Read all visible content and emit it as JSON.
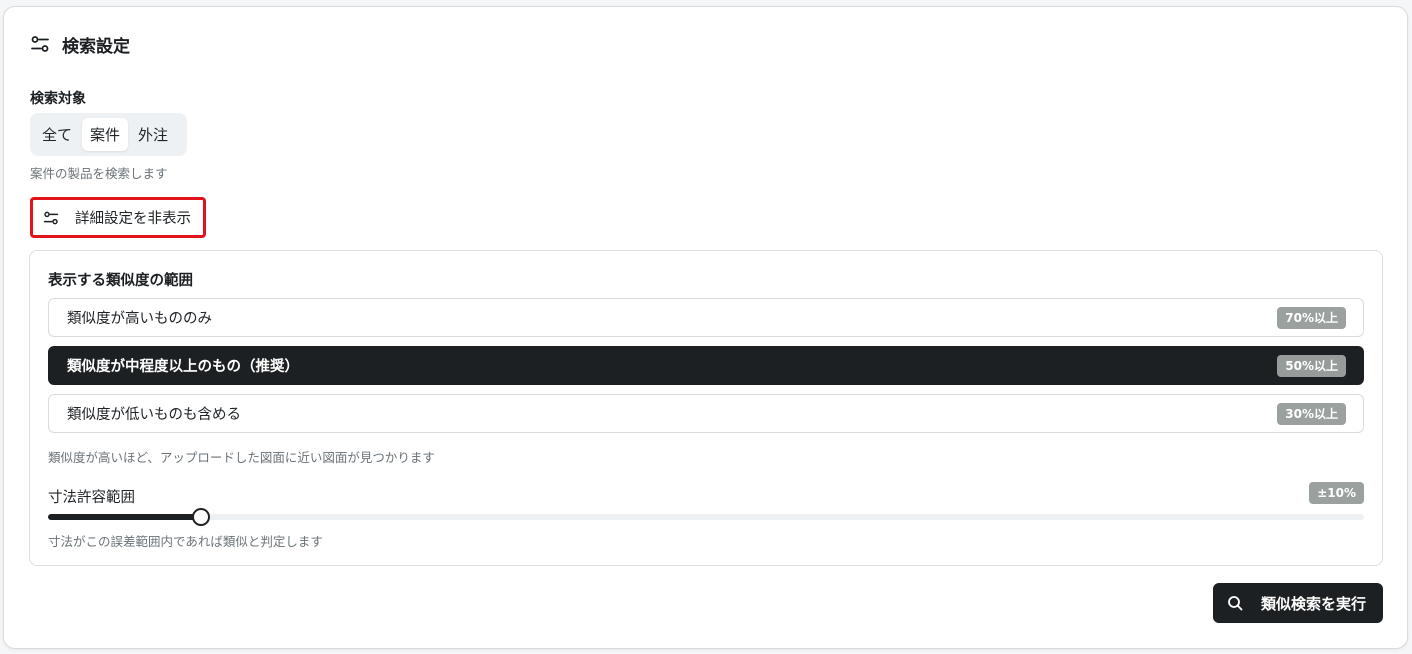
{
  "header": {
    "title": "検索設定",
    "icon": "sliders-icon"
  },
  "search_target": {
    "label": "検索対象",
    "options": [
      "全て",
      "案件",
      "外注"
    ],
    "selected": "案件",
    "help": "案件の製品を検索します"
  },
  "details_toggle": {
    "label": "詳細設定を非表示",
    "icon": "sliders-icon"
  },
  "similarity": {
    "title": "表示する類似度の範囲",
    "options": [
      {
        "label": "類似度が高いもののみ",
        "badge": "70%以上"
      },
      {
        "label": "類似度が中程度以上のもの（推奨）",
        "badge": "50%以上"
      },
      {
        "label": "類似度が低いものも含める",
        "badge": "30%以上"
      }
    ],
    "selected_index": 1,
    "help": "類似度が高いほど、アップロードした図面に近い図面が見つかります"
  },
  "tolerance": {
    "label": "寸法許容範囲",
    "value_label": "±10%",
    "slider_fraction": 0.116,
    "help": "寸法がこの誤差範囲内であれば類似と判定します"
  },
  "run_button": {
    "label": "類似検索を実行",
    "icon": "search-icon"
  },
  "colors": {
    "primary": "#1d2022",
    "badge": "#9aa19f",
    "highlight": "#e0141a"
  }
}
